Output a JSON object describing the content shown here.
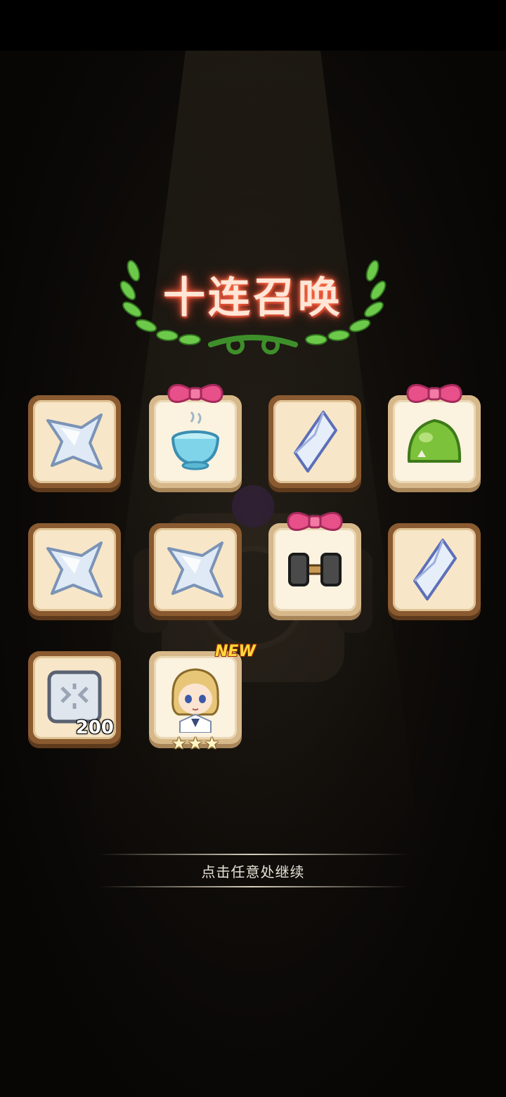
{
  "title": "十连召唤",
  "continue_hint": "点击任意处继续",
  "rewards": [
    {
      "icon": "star-crystal-icon",
      "gift": false
    },
    {
      "icon": "water-bowl-icon",
      "gift": true
    },
    {
      "icon": "diamond-crystal-icon",
      "gift": false
    },
    {
      "icon": "green-slime-icon",
      "gift": true
    },
    {
      "icon": "star-crystal-icon",
      "gift": false
    },
    {
      "icon": "star-crystal-icon",
      "gift": false
    },
    {
      "icon": "dumbbell-icon",
      "gift": true
    },
    {
      "icon": "diamond-crystal-icon",
      "gift": false
    },
    {
      "icon": "stone-tile-icon",
      "gift": false,
      "quantity": "200"
    },
    {
      "icon": "hero-portrait-icon",
      "gift": false,
      "badge": "NEW",
      "stars": 3
    }
  ],
  "colors": {
    "title_glow": "#ff6040",
    "frame_brown": "#8a5a30",
    "panel_cream": "#f7e6c8",
    "bow_pink": "#e8508a",
    "new_yellow": "#ffd93b"
  }
}
